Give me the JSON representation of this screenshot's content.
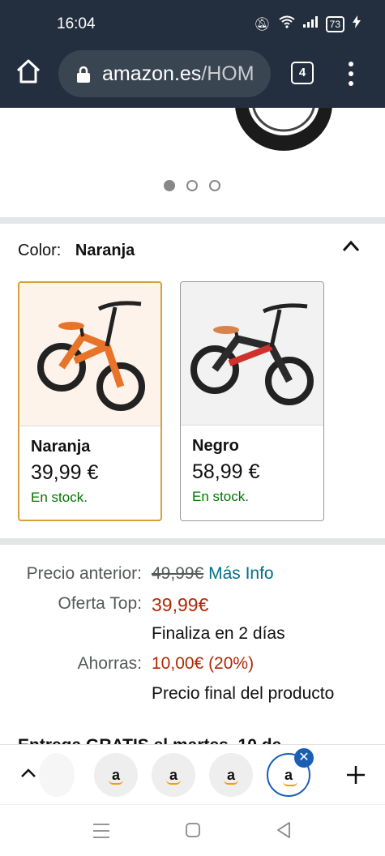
{
  "status": {
    "time": "16:04",
    "battery": "73"
  },
  "browser": {
    "url_domain": "amazon.es",
    "url_path": "/HOM",
    "tab_count": "4"
  },
  "color_selector": {
    "label": "Color:",
    "selected": "Naranja",
    "options": [
      {
        "name": "Naranja",
        "price": "39,99 €",
        "stock": "En stock.",
        "accent": "#e8742a"
      },
      {
        "name": "Negro",
        "price": "58,99 €",
        "stock": "En stock.",
        "accent": "#d0312d"
      }
    ]
  },
  "pricing": {
    "previous_label": "Precio anterior:",
    "previous_value": "49,99€",
    "more_info": "Más Info",
    "offer_label": "Oferta Top:",
    "offer_value": "39,99€",
    "ends": "Finaliza en 2 días",
    "savings_label": "Ahorras:",
    "savings_value": "10,00€ (20%)",
    "final_note": "Precio final del producto"
  },
  "cutoff_text": "Entrega GRATIS el martes, 10 de",
  "tab_strip": {
    "tab_letter": "a"
  },
  "colors": {
    "header_bg": "#232f3e",
    "link": "#007185",
    "deal_red": "#b12704",
    "stock_green": "#007600",
    "selected_border": "#d6a13c"
  }
}
